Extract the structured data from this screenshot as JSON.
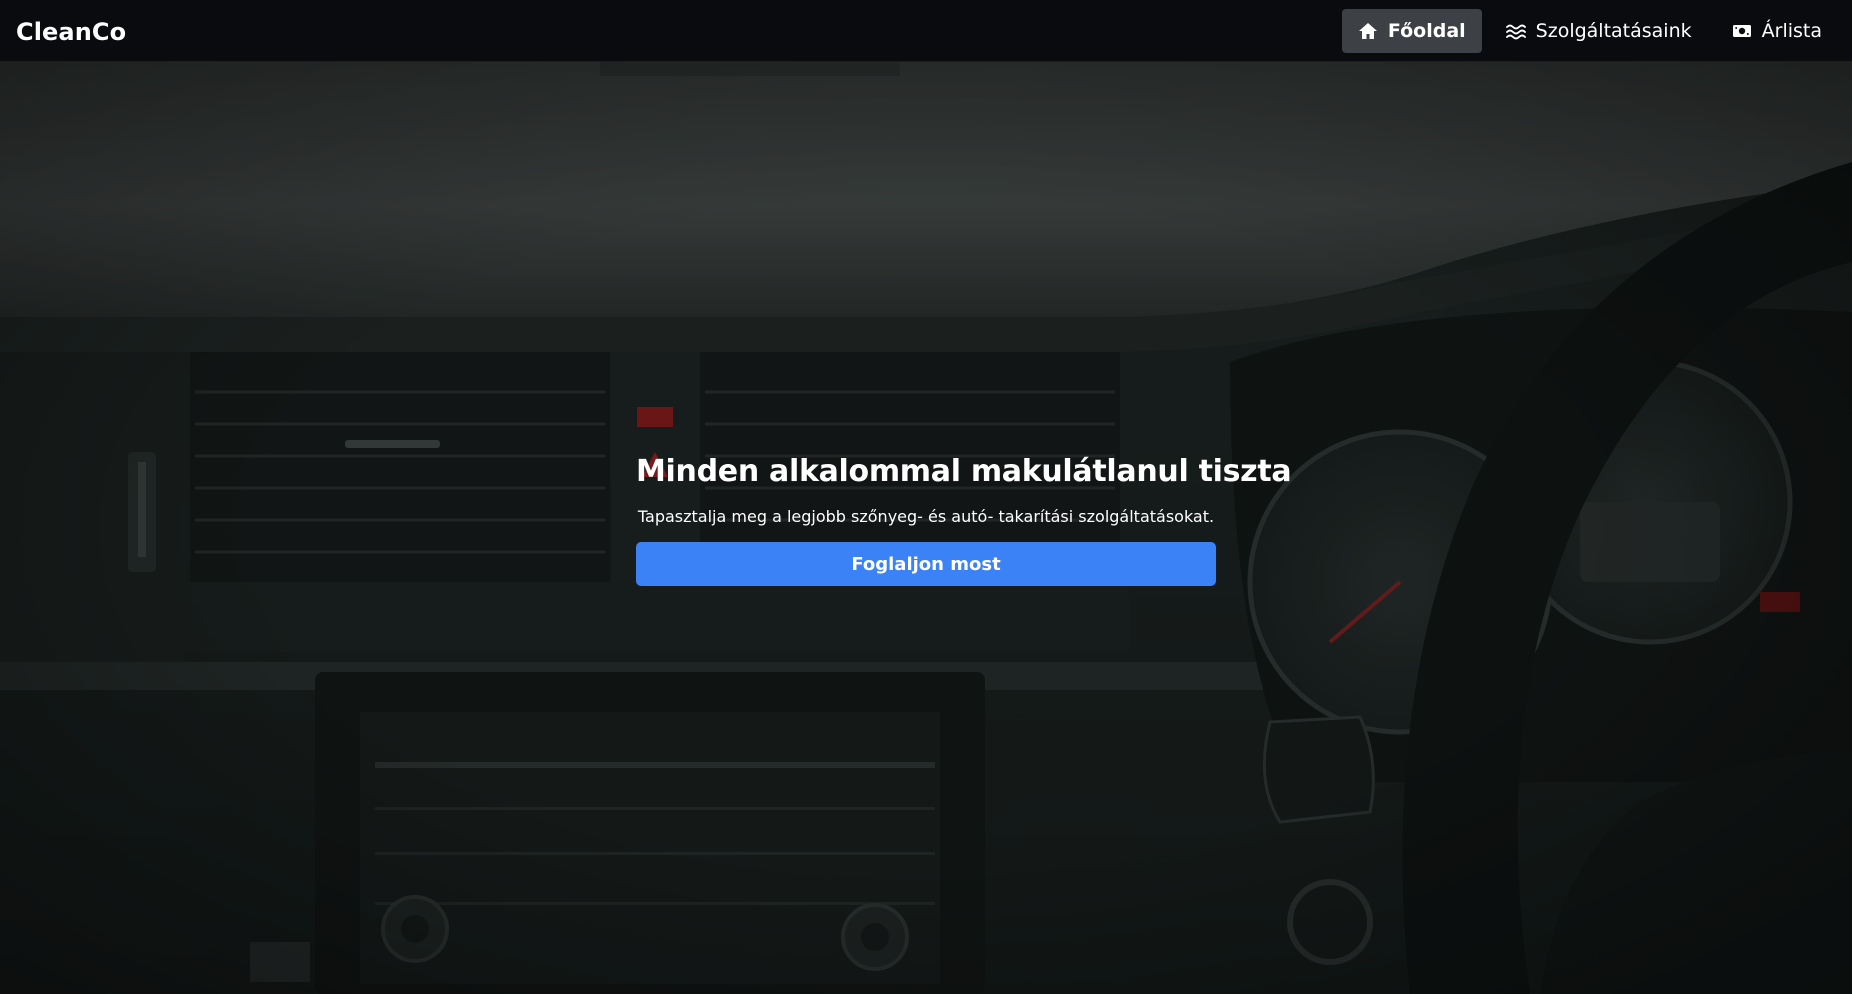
{
  "brand": {
    "name": "CleanCo"
  },
  "nav": {
    "items": [
      {
        "label": "Főoldal",
        "icon": "home-icon",
        "active": true
      },
      {
        "label": "Szolgáltatásaink",
        "icon": "waves-icon",
        "active": false
      },
      {
        "label": "Árlista",
        "icon": "money-icon",
        "active": false
      }
    ]
  },
  "hero": {
    "title": "Minden alkalommal makulátlanul tiszta",
    "subtitle": "Tapasztalja meg a legjobb szőnyeg- és autó- takarítási szolgáltatásokat.",
    "cta_label": "Foglaljon most",
    "background_image": "car-interior-dashboard"
  },
  "colors": {
    "navbar_bg": "#090b0f",
    "active_nav_bg": "#3d4045",
    "cta_bg": "#3b82f6",
    "text": "#ffffff"
  }
}
